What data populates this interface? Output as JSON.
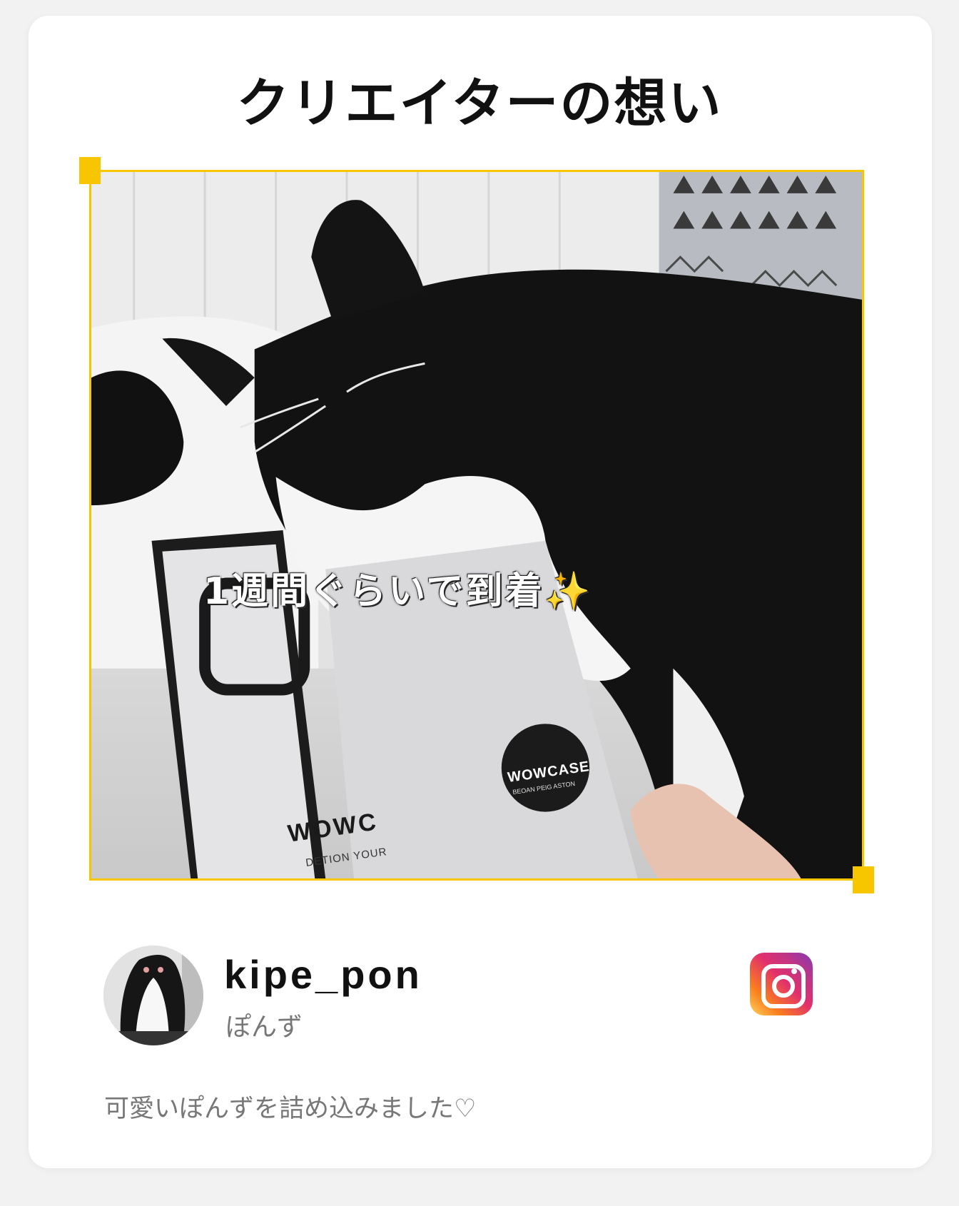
{
  "header": {
    "title": "クリエイターの想い"
  },
  "photo": {
    "caption": "1週間ぐらいで到着",
    "caption_emoji": "✨",
    "product_box_text": "WOWC",
    "product_box_subtext": "DETION YOUR",
    "sticker_text": "WOWCASE",
    "sticker_subtext": "BEOAN PEIG ASTON"
  },
  "creator": {
    "username": "kipe_pon",
    "display_name": "ぽんず",
    "social_icon": "instagram-icon",
    "comment": "可愛いぽんずを詰め込みました♡"
  },
  "colors": {
    "accent": "#f7c600",
    "card_bg": "#ffffff",
    "page_bg": "#f2f2f2",
    "text_muted": "#777777"
  }
}
